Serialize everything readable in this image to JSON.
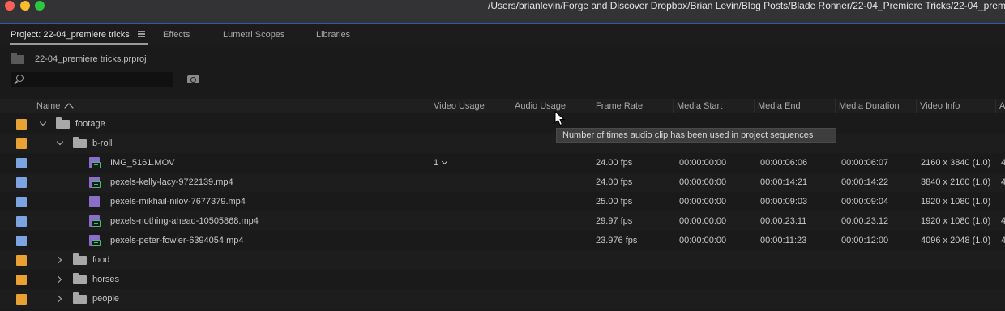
{
  "window": {
    "title_path": "/Users/brianlevin/Forge and Discover Dropbox/Brian Levin/Blog Posts/Blade Ronner/22-04_Premiere Tricks/22-04_premie"
  },
  "tabs": [
    {
      "label": "Project: 22-04_premiere tricks",
      "active": true
    },
    {
      "label": "Effects"
    },
    {
      "label": "Lumetri Scopes"
    },
    {
      "label": "Libraries"
    }
  ],
  "project": {
    "file_name": "22-04_premiere tricks.prproj",
    "search_value": "",
    "search_placeholder": ""
  },
  "columns": {
    "name": "Name",
    "video_usage": "Video Usage",
    "audio_usage": "Audio Usage",
    "frame_rate": "Frame Rate",
    "media_start": "Media Start",
    "media_end": "Media End",
    "media_duration": "Media Duration",
    "video_info": "Video Info",
    "overflow": "A"
  },
  "rows": [
    {
      "name": "footage",
      "video_usage": "",
      "frame_rate": "",
      "media_start": "",
      "media_end": "",
      "media_duration": "",
      "video_info": "",
      "extra": ""
    },
    {
      "name": "b-roll",
      "video_usage": "",
      "frame_rate": "",
      "media_start": "",
      "media_end": "",
      "media_duration": "",
      "video_info": "",
      "extra": ""
    },
    {
      "name": "IMG_5161.MOV",
      "video_usage": "1",
      "frame_rate": "24.00 fps",
      "media_start": "00:00:00:00",
      "media_end": "00:00:06:06",
      "media_duration": "00:00:06:07",
      "video_info": "2160 x 3840 (1.0)",
      "extra": "4"
    },
    {
      "name": "pexels-kelly-lacy-9722139.mp4",
      "video_usage": "",
      "frame_rate": "24.00 fps",
      "media_start": "00:00:00:00",
      "media_end": "00:00:14:21",
      "media_duration": "00:00:14:22",
      "video_info": "3840 x 2160 (1.0)",
      "extra": "4"
    },
    {
      "name": "pexels-mikhail-nilov-7677379.mp4",
      "video_usage": "",
      "frame_rate": "25.00 fps",
      "media_start": "00:00:00:00",
      "media_end": "00:00:09:03",
      "media_duration": "00:00:09:04",
      "video_info": "1920 x 1080 (1.0)",
      "extra": ""
    },
    {
      "name": "pexels-nothing-ahead-10505868.mp4",
      "video_usage": "",
      "frame_rate": "29.97 fps",
      "media_start": "00:00:00:00",
      "media_end": "00:00:23:11",
      "media_duration": "00:00:23:12",
      "video_info": "1920 x 1080 (1.0)",
      "extra": "4"
    },
    {
      "name": "pexels-peter-fowler-6394054.mp4",
      "video_usage": "",
      "frame_rate": "23.976 fps",
      "media_start": "00:00:00:00",
      "media_end": "00:00:11:23",
      "media_duration": "00:00:12:00",
      "video_info": "4096 x 2048 (1.0)",
      "extra": "4"
    },
    {
      "name": "food",
      "video_usage": "",
      "frame_rate": "",
      "media_start": "",
      "media_end": "",
      "media_duration": "",
      "video_info": "",
      "extra": ""
    },
    {
      "name": "horses",
      "video_usage": "",
      "frame_rate": "",
      "media_start": "",
      "media_end": "",
      "media_duration": "",
      "video_info": "",
      "extra": ""
    },
    {
      "name": "people",
      "video_usage": "",
      "frame_rate": "",
      "media_start": "",
      "media_end": "",
      "media_duration": "",
      "video_info": "",
      "extra": ""
    }
  ],
  "tooltip": {
    "text": "Number of times audio clip has been used in project sequences"
  },
  "colors": {
    "bin_label": "#e8a133",
    "clip_label": "#7ba4e0",
    "clip_icon": "#8a6ec9",
    "clip_badge": "#3fbf6f",
    "accent_border": "#2c5fa8"
  },
  "icons": {
    "sort": "chevron-up-icon",
    "expand": "chevron-down-icon",
    "collapse": "chevron-right-icon",
    "bin": "folder-icon",
    "clip": "video-clip-icon"
  }
}
